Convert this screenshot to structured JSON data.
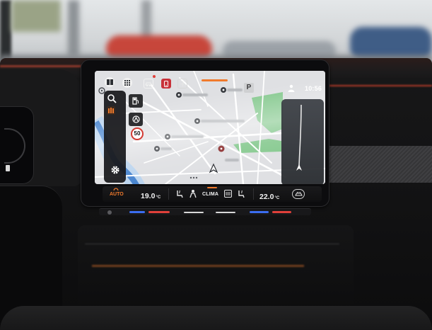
{
  "status_bar": {
    "time": "10:56",
    "parking_badge": "P"
  },
  "navigation": {
    "speed_limit": "50"
  },
  "climate": {
    "auto_label": "AUTO",
    "left_temp": "19.0",
    "left_unit": "°C",
    "clima_label": "CLIMA",
    "right_temp": "22.0",
    "right_unit": "°C"
  },
  "icons": {
    "top_bar": [
      "window-icon",
      "apps-grid-icon",
      "car-icon",
      "phone-icon",
      "add-icon",
      "parking-icon",
      "user-profile-icon"
    ],
    "map_sidebar": [
      "search-location-icon",
      "map-layers-icon",
      "settings-gear-icon"
    ],
    "map_buttons": [
      "fuel-station-icon",
      "route-icon"
    ],
    "climate_bar": [
      "auto-fan-icon",
      "seat-heating-icon",
      "fan-icon",
      "rear-defrost-icon",
      "steering-heat-icon",
      "recirculation-car-icon"
    ]
  },
  "colors": {
    "accent_orange": "#f07a2c",
    "phone_red": "#c8323a",
    "map_background": "#dfe0e3",
    "water_blue": "#4a86d0",
    "park_green": "#86c98f",
    "led_blue": "#3b6df0",
    "led_red": "#e0403a"
  }
}
